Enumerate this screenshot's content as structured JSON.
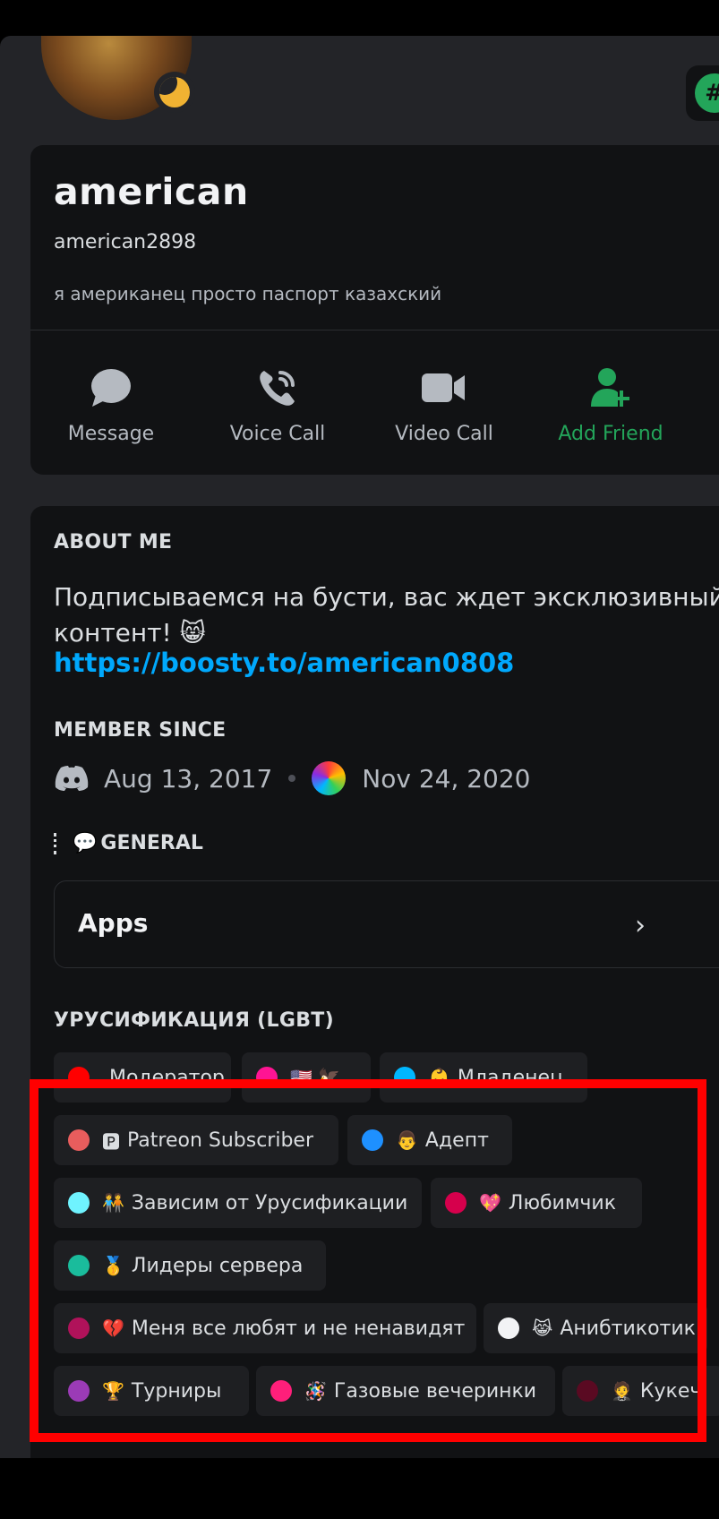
{
  "profile": {
    "display_name": "american",
    "username": "american2898",
    "custom_status": "я американец просто паспорт казахский",
    "status": "idle",
    "nitro_chip_glyph": "#"
  },
  "actions": [
    {
      "label": "Message",
      "icon": "chat-bubble-icon"
    },
    {
      "label": "Voice Call",
      "icon": "phone-icon"
    },
    {
      "label": "Video Call",
      "icon": "video-camera-icon"
    },
    {
      "label": "Add Friend",
      "icon": "add-friend-icon"
    }
  ],
  "about": {
    "heading": "ABOUT ME",
    "text": "Подписываемся на бусти, вас ждет эксклюзивный контент! 😸",
    "link": "https://boosty.to/american0808"
  },
  "member_since": {
    "heading": "MEMBER SINCE",
    "discord_date": "Aug 13, 2017",
    "server_date": "Nov 24, 2020"
  },
  "general": {
    "heading_emoji": "💬",
    "heading": "GENERAL",
    "apps_label": "Apps",
    "apps_chevron": "›"
  },
  "roles_section": {
    "heading": "УРУСИФИКАЦИЯ (LGBT)",
    "roles": [
      {
        "label": "Модератор",
        "emoji": "",
        "color": "#ff0000"
      },
      {
        "label": "",
        "emoji": "🇺🇸 🦅",
        "color": "#ff1493"
      },
      {
        "label": "Младенец",
        "emoji": "👶",
        "color": "#00b7ff"
      },
      {
        "label": "Patreon Subscriber",
        "emoji": "🅿",
        "color": "#e85d5d"
      },
      {
        "label": "Адепт",
        "emoji": "👨",
        "color": "#1e90ff"
      },
      {
        "label": "Зависим от Урусификации",
        "emoji": "🧑‍🤝‍🧑",
        "color": "#6ff3ff"
      },
      {
        "label": "Любимчик",
        "emoji": "💖",
        "color": "#d6004c"
      },
      {
        "label": "Лидеры сервера",
        "emoji": "🥇",
        "color": "#1abc9c"
      },
      {
        "label": "Меня все любят и не ненавидят",
        "emoji": "💔",
        "color": "#b0125a"
      },
      {
        "label": "Анибтикотик",
        "emoji": "😹",
        "color": "#f2f3f5"
      },
      {
        "label": "Турниры",
        "emoji": "🏆",
        "color": "#9b3bb6"
      },
      {
        "label": "Газовые вечеринки",
        "emoji": "🪅",
        "color": "#ff1f7a"
      },
      {
        "label": "Кукеч",
        "emoji": "🤵",
        "color": "#5a0a22"
      }
    ]
  }
}
